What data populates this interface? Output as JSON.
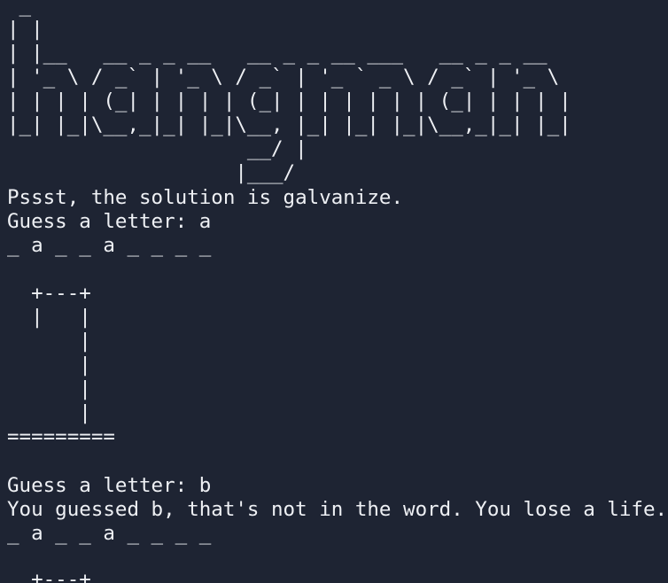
{
  "terminal": {
    "background": "#1e2433",
    "foreground": "#eef0f4",
    "lines": [
      " _",
      "| |",
      "| |__   __ _ _ __   __ _ _ __ ___   __ _ _ __",
      "| '_ \\ / _` | '_ \\ / _` | '_ ` _ \\ / _` | '_ \\",
      "| | | | (_| | | | | (_| | | | | | | (_| | | | |",
      "|_| |_|\\__,_|_| |_|\\__, |_| |_| |_|\\__,_|_| |_|",
      "                    __/ |",
      "                   |___/",
      "Pssst, the solution is galvanize.",
      "Guess a letter: a",
      "_ a _ _ a _ _ _ _",
      "",
      "  +---+",
      "  |   |",
      "      |",
      "      |",
      "      |",
      "      |",
      "=========",
      "",
      "Guess a letter: b",
      "You guessed b, that's not in the word. You lose a life.",
      "_ a _ _ a _ _ _ _",
      "",
      "  +---+"
    ]
  }
}
